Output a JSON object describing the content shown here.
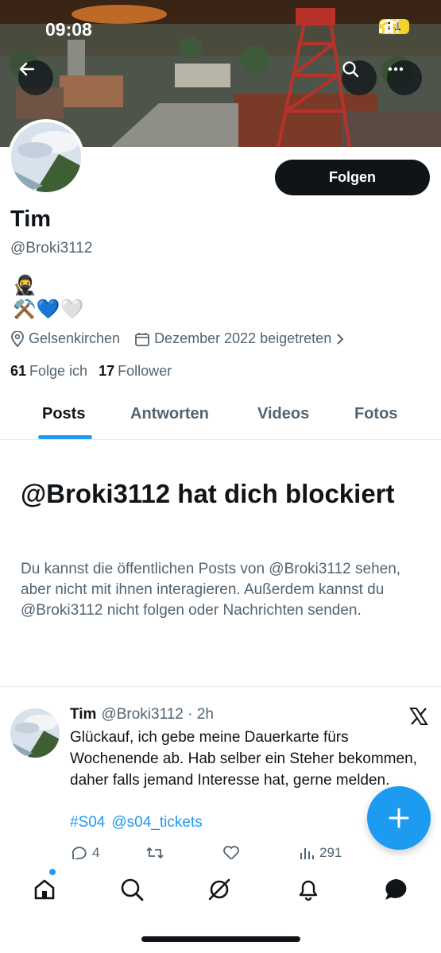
{
  "status_bar": {
    "time": "09:08",
    "battery": "51"
  },
  "header": {
    "back_icon": "back-arrow-icon",
    "search_icon": "search-icon",
    "more_icon": "more-icon"
  },
  "profile": {
    "follow_label": "Folgen",
    "name": "Tim",
    "handle": "@Broki3112",
    "bio_line1": "🥷",
    "bio_line2": "⚒️💙🤍",
    "location": "Gelsenkirchen",
    "joined": "Dezember 2022 beigetreten",
    "following_count": "61",
    "following_label": "Folge ich",
    "followers_count": "17",
    "followers_label": "Follower"
  },
  "tabs": [
    {
      "label": "Posts",
      "active": true
    },
    {
      "label": "Antworten",
      "active": false
    },
    {
      "label": "Videos",
      "active": false
    },
    {
      "label": "Fotos",
      "active": false
    }
  ],
  "blocked": {
    "title": "@Broki3112 hat dich blockiert",
    "text": "Du kannst die öffentlichen Posts von @Broki3112 sehen, aber nicht mit ihnen interagieren. Außerdem kannst du @Broki3112 nicht folgen oder Nachrichten senden."
  },
  "tweet": {
    "name": "Tim",
    "handle_time": "@Broki3112 · 2h",
    "body": "Glückauf, ich gebe meine Dauerkarte fürs Wochenende ab. Hab selber ein Steher bekommen, daher falls jemand Interesse hat, gerne melden.",
    "tag1": "#S04",
    "tag2": "@s04_tickets",
    "replies": "4",
    "views": "291"
  },
  "colors": {
    "accent": "#1d9bf0",
    "text": "#0f1419",
    "secondary": "#536471"
  }
}
